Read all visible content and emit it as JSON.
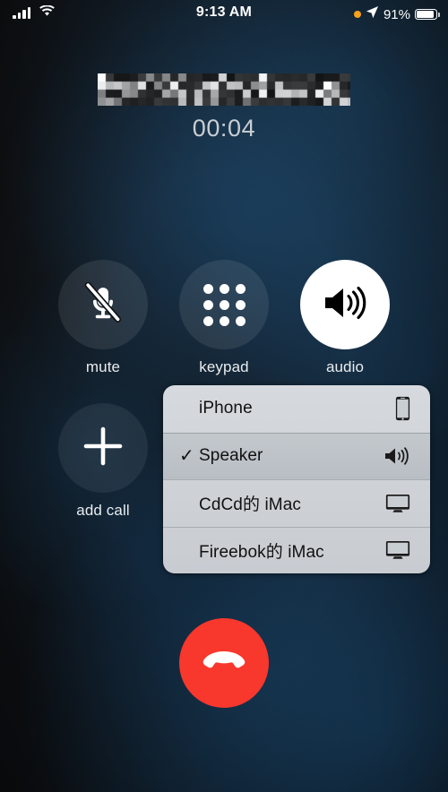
{
  "status_bar": {
    "signal_icon": "cellular-signal-icon",
    "signal_bars": 4,
    "wifi_icon": "wifi-icon",
    "time": "9:13 AM",
    "recording_icon": "orange-recording-dot-icon",
    "location_icon": "location-arrow-icon",
    "battery_percent": "91%",
    "battery_level": 91,
    "battery_icon": "battery-icon"
  },
  "call": {
    "caller_name_redacted": true,
    "caller_name_note": "pixelated",
    "duration": "00:04"
  },
  "controls": [
    {
      "id": "mute",
      "label": "mute",
      "icon": "microphone-slash-icon",
      "active": false
    },
    {
      "id": "keypad",
      "label": "keypad",
      "icon": "keypad-dots-icon",
      "active": false
    },
    {
      "id": "audio",
      "label": "audio",
      "icon": "speaker-waves-icon",
      "active": true
    },
    {
      "id": "add_call",
      "label": "add call",
      "icon": "plus-icon",
      "active": false
    }
  ],
  "end_call": {
    "label": "end call",
    "icon": "phone-down-icon",
    "color": "#f8372d"
  },
  "audio_route_menu": {
    "items": [
      {
        "label": "iPhone",
        "icon": "iphone-icon",
        "selected": false,
        "check": ""
      },
      {
        "label": "Speaker",
        "icon": "speaker-waves-icon",
        "selected": true,
        "check": "✓"
      },
      {
        "label": "CdCd的 iMac",
        "icon": "imac-display-icon",
        "selected": false,
        "check": ""
      },
      {
        "label": "Fireebok的 iMac",
        "icon": "imac-display-icon",
        "selected": false,
        "check": ""
      }
    ]
  },
  "colors": {
    "accent_end_call": "#f8372d",
    "status_recording": "#f5a11b",
    "menu_background": "#cdd1d6",
    "active_button": "#ffffff"
  }
}
